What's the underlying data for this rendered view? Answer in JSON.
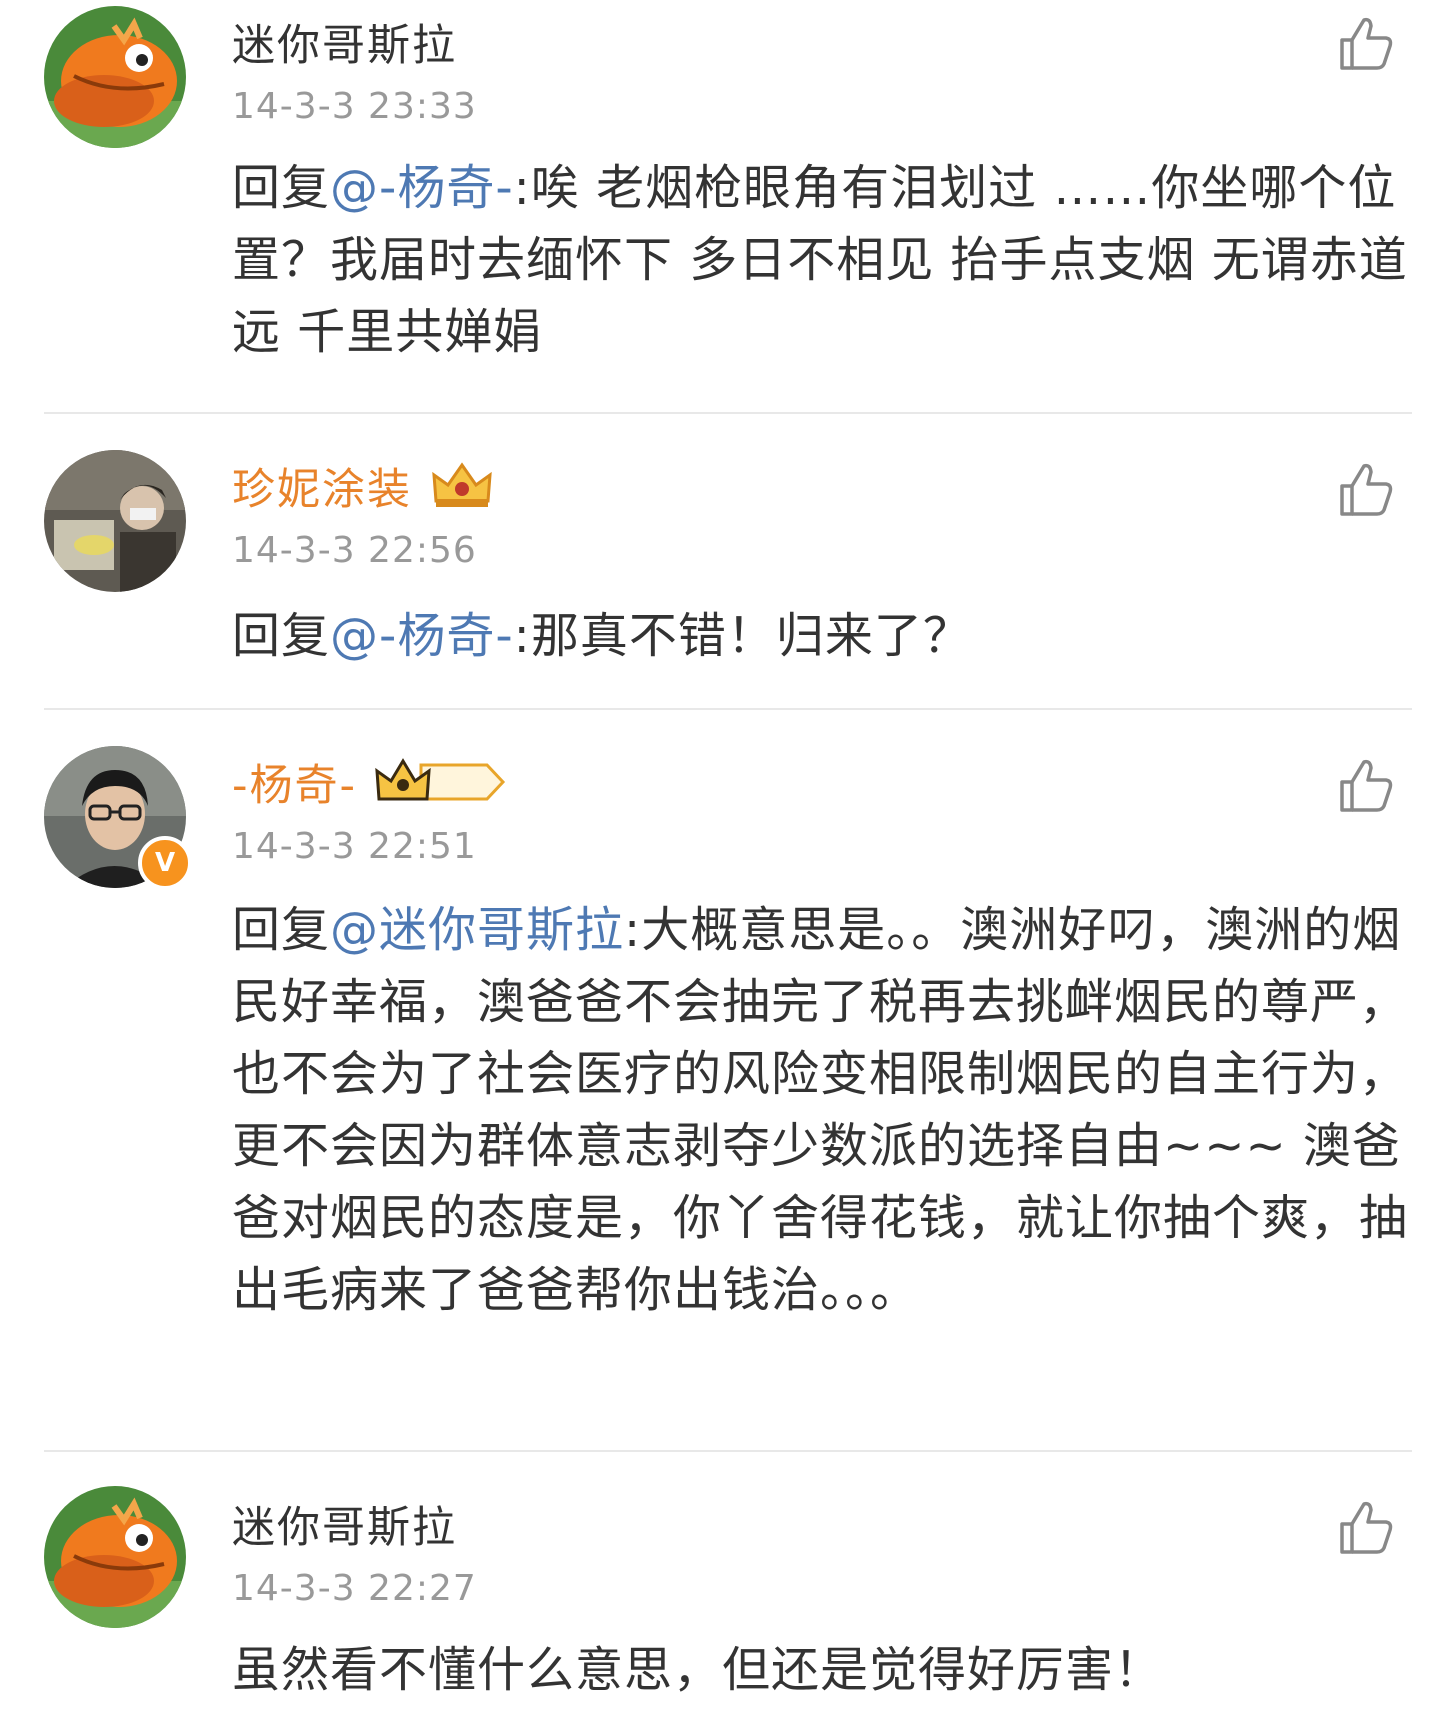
{
  "comments": [
    {
      "username": "迷你哥斯拉",
      "timestamp": "14-3-3 23:33",
      "reply_prefix": "回复",
      "mention": "@-杨奇-",
      "text": ":唉 老烟枪眼角有泪划过 ……你坐哪个位置？我届时去缅怀下 多日不相见 抬手点支烟 无谓赤道远 千里共婵娟",
      "avatar": "godzilla-avatar"
    },
    {
      "username": "珍妮涂装",
      "timestamp": "14-3-3 22:56",
      "reply_prefix": "回复",
      "mention": "@-杨奇-",
      "text": ":那真不错！归来了？",
      "avatar": "photo-avatar",
      "badge": "crown-badge-icon"
    },
    {
      "username": "-杨奇-",
      "timestamp": "14-3-3 22:51",
      "reply_prefix": "回复",
      "mention": "@迷你哥斯拉",
      "text": ":大概意思是。。澳洲好叼，澳洲的烟民好幸福，澳爸爸不会抽完了税再去挑衅烟民的尊严，也不会为了社会医疗的风险变相限制烟民的自主行为，更不会因为群体意志剥夺少数派的选择自由~~~ 澳爸爸对烟民的态度是，你丫舍得花钱，就让你抽个爽，抽出毛病来了爸爸帮你出钱治。。。",
      "avatar": "person-avatar",
      "verified_badge": "V",
      "level_badge": "I"
    },
    {
      "username": "迷你哥斯拉",
      "timestamp": "14-3-3 22:27",
      "text": "虽然看不懂什么意思，但还是觉得好厉害！",
      "avatar": "godzilla-avatar"
    }
  ],
  "colors": {
    "mention": "#4e79b3",
    "vip_name": "#e8832b",
    "timestamp": "#999999",
    "divider": "#e8e8e8",
    "verified": "#f7931e"
  }
}
